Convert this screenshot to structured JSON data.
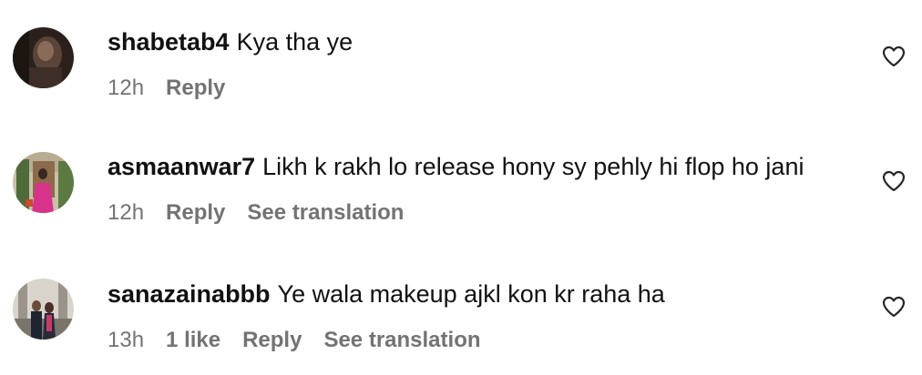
{
  "comments": [
    {
      "username": "shabetab4",
      "text": "Kya tha ye",
      "time": "12h",
      "likes": "",
      "reply": "Reply",
      "translate": "",
      "avatar_icon": "user-avatar-dark"
    },
    {
      "username": "asmaanwar7",
      "text": "Likh k rakh lo release hony sy pehly hi flop ho jani",
      "time": "12h",
      "likes": "",
      "reply": "Reply",
      "translate": "See translation",
      "avatar_icon": "user-avatar-garden"
    },
    {
      "username": "sanazainabbb",
      "text": "Ye wala makeup ajkl kon kr raha ha",
      "time": "13h",
      "likes": "1 like",
      "reply": "Reply",
      "translate": "See translation",
      "avatar_icon": "user-avatar-couple"
    }
  ],
  "colors": {
    "text": "#111111",
    "meta": "#737373",
    "background": "#ffffff"
  },
  "icons": {
    "like": "heart-outline-icon"
  }
}
